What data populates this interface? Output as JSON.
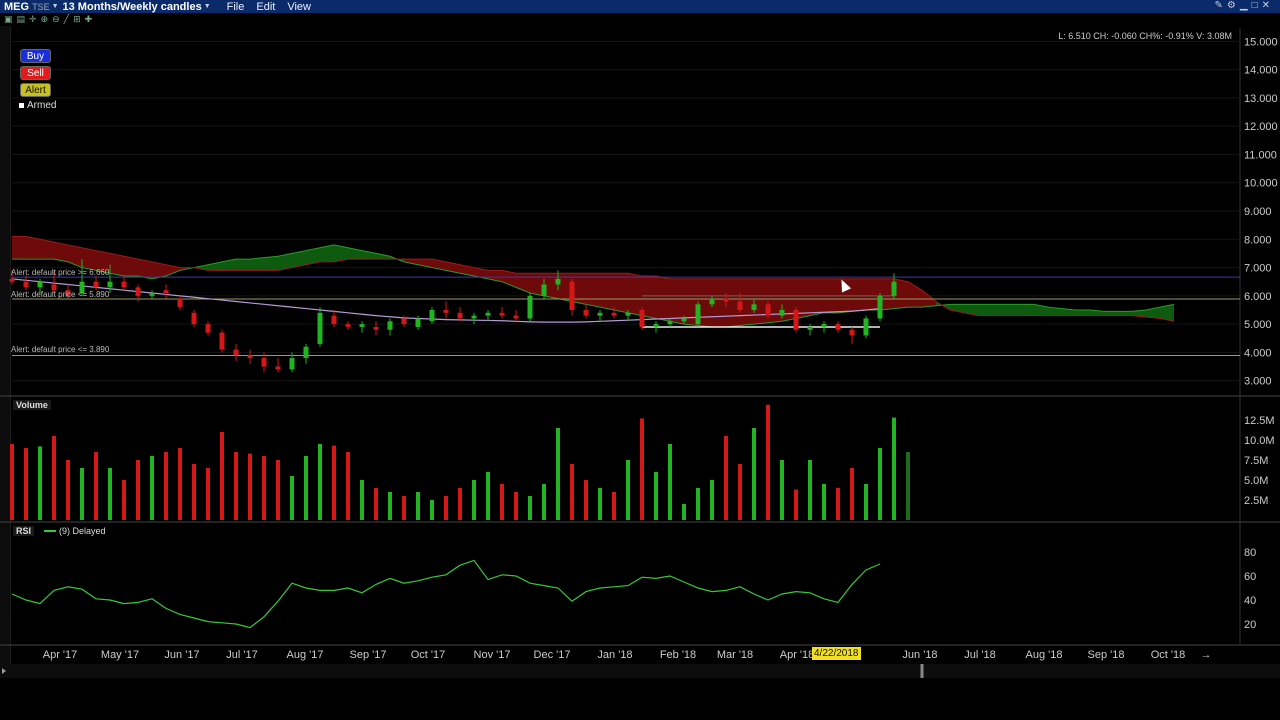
{
  "header": {
    "symbol": "MEG",
    "exchange": "TSE",
    "period": "13 Months/Weekly candles",
    "menus": [
      "File",
      "Edit",
      "View"
    ]
  },
  "actions": {
    "buy": "Buy",
    "sell": "Sell",
    "alert": "Alert",
    "armed": "Armed"
  },
  "quote": "L: 6.510  CH: -0.060  CH%: -0.91%  V: 3.08M",
  "alerts": [
    "Alert: default price >= 6.660",
    "Alert: default price <= 5.890",
    "Alert: default price <= 3.890"
  ],
  "highlighted_date": "4/22/2018",
  "panels": {
    "volume_label": "Volume",
    "rsi_label": "RSI",
    "rsi_params": "(9) Delayed"
  },
  "colors": {
    "up": "#22b422",
    "down": "#d41818",
    "cloud_bull": "#0e5a0e",
    "cloud_bear": "#6e0a0a",
    "ma": "#b49bd8",
    "rsi": "#38c838",
    "alert_line": "#9a9a62"
  },
  "chart_data": [
    {
      "type": "candlestick",
      "title": "",
      "x_tick_labels": [
        "Apr '17",
        "May '17",
        "Jun '17",
        "Jul '17",
        "Aug '17",
        "Sep '17",
        "Oct '17",
        "Nov '17",
        "Dec '17",
        "Jan '18",
        "Feb '18",
        "Mar '18",
        "Apr '18",
        "Jun '18",
        "Jul '18",
        "Aug '18",
        "Sep '18",
        "Oct '18"
      ],
      "y_tick_labels": [
        "15.000",
        "14.000",
        "13.000",
        "12.000",
        "11.000",
        "10.000",
        "9.000",
        "8.000",
        "7.000",
        "6.000",
        "5.000",
        "4.000",
        "3.000"
      ],
      "ylim": [
        2.6,
        15.4
      ],
      "candles": [
        {
          "o": 6.6,
          "h": 6.9,
          "l": 6.4,
          "c": 6.5
        },
        {
          "o": 6.5,
          "h": 6.7,
          "l": 6.2,
          "c": 6.3
        },
        {
          "o": 6.3,
          "h": 6.6,
          "l": 6.1,
          "c": 6.5
        },
        {
          "o": 6.4,
          "h": 6.9,
          "l": 6.1,
          "c": 6.2
        },
        {
          "o": 6.2,
          "h": 6.4,
          "l": 5.9,
          "c": 6.0
        },
        {
          "o": 6.1,
          "h": 7.3,
          "l": 6.0,
          "c": 6.5
        },
        {
          "o": 6.5,
          "h": 6.7,
          "l": 6.2,
          "c": 6.3
        },
        {
          "o": 6.3,
          "h": 7.1,
          "l": 6.1,
          "c": 6.5
        },
        {
          "o": 6.5,
          "h": 6.7,
          "l": 6.2,
          "c": 6.3
        },
        {
          "o": 6.3,
          "h": 6.4,
          "l": 5.8,
          "c": 6.0
        },
        {
          "o": 6.0,
          "h": 6.2,
          "l": 5.9,
          "c": 6.1
        },
        {
          "o": 6.2,
          "h": 6.4,
          "l": 5.9,
          "c": 6.1
        },
        {
          "o": 5.9,
          "h": 6.0,
          "l": 5.5,
          "c": 5.6
        },
        {
          "o": 5.4,
          "h": 5.5,
          "l": 4.9,
          "c": 5.0
        },
        {
          "o": 5.0,
          "h": 5.1,
          "l": 4.6,
          "c": 4.7
        },
        {
          "o": 4.7,
          "h": 4.8,
          "l": 4.0,
          "c": 4.1
        },
        {
          "o": 4.1,
          "h": 4.3,
          "l": 3.7,
          "c": 3.9
        },
        {
          "o": 3.9,
          "h": 4.1,
          "l": 3.6,
          "c": 3.8
        },
        {
          "o": 3.8,
          "h": 4.0,
          "l": 3.3,
          "c": 3.5
        },
        {
          "o": 3.5,
          "h": 3.8,
          "l": 3.3,
          "c": 3.4
        },
        {
          "o": 3.4,
          "h": 4.0,
          "l": 3.3,
          "c": 3.8
        },
        {
          "o": 3.8,
          "h": 4.3,
          "l": 3.6,
          "c": 4.2
        },
        {
          "o": 4.3,
          "h": 5.6,
          "l": 4.2,
          "c": 5.4
        },
        {
          "o": 5.3,
          "h": 5.5,
          "l": 4.9,
          "c": 5.0
        },
        {
          "o": 5.0,
          "h": 5.1,
          "l": 4.8,
          "c": 4.9
        },
        {
          "o": 4.9,
          "h": 5.1,
          "l": 4.7,
          "c": 5.0
        },
        {
          "o": 4.9,
          "h": 5.1,
          "l": 4.6,
          "c": 4.8
        },
        {
          "o": 4.8,
          "h": 5.2,
          "l": 4.6,
          "c": 5.1
        },
        {
          "o": 5.2,
          "h": 5.3,
          "l": 4.9,
          "c": 5.0
        },
        {
          "o": 4.9,
          "h": 5.3,
          "l": 4.8,
          "c": 5.2
        },
        {
          "o": 5.1,
          "h": 5.6,
          "l": 5.0,
          "c": 5.5
        },
        {
          "o": 5.5,
          "h": 5.8,
          "l": 5.2,
          "c": 5.4
        },
        {
          "o": 5.4,
          "h": 5.6,
          "l": 5.1,
          "c": 5.2
        },
        {
          "o": 5.2,
          "h": 5.4,
          "l": 5.0,
          "c": 5.3
        },
        {
          "o": 5.3,
          "h": 5.5,
          "l": 5.1,
          "c": 5.4
        },
        {
          "o": 5.4,
          "h": 5.6,
          "l": 5.2,
          "c": 5.3
        },
        {
          "o": 5.3,
          "h": 5.5,
          "l": 5.1,
          "c": 5.2
        },
        {
          "o": 5.2,
          "h": 6.1,
          "l": 5.1,
          "c": 6.0
        },
        {
          "o": 6.0,
          "h": 6.6,
          "l": 5.9,
          "c": 6.4
        },
        {
          "o": 6.4,
          "h": 6.9,
          "l": 6.2,
          "c": 6.6
        },
        {
          "o": 6.5,
          "h": 6.6,
          "l": 5.3,
          "c": 5.5
        },
        {
          "o": 5.5,
          "h": 5.7,
          "l": 5.2,
          "c": 5.3
        },
        {
          "o": 5.3,
          "h": 5.5,
          "l": 5.1,
          "c": 5.4
        },
        {
          "o": 5.4,
          "h": 5.6,
          "l": 5.2,
          "c": 5.3
        },
        {
          "o": 5.3,
          "h": 5.5,
          "l": 5.1,
          "c": 5.4
        },
        {
          "o": 5.5,
          "h": 5.6,
          "l": 4.8,
          "c": 4.9
        },
        {
          "o": 4.9,
          "h": 5.1,
          "l": 4.7,
          "c": 5.0
        },
        {
          "o": 5.0,
          "h": 5.2,
          "l": 4.9,
          "c": 5.1
        },
        {
          "o": 5.1,
          "h": 5.3,
          "l": 5.0,
          "c": 5.2
        },
        {
          "o": 5.0,
          "h": 5.8,
          "l": 4.9,
          "c": 5.7
        },
        {
          "o": 5.7,
          "h": 6.0,
          "l": 5.6,
          "c": 5.9
        },
        {
          "o": 5.9,
          "h": 6.1,
          "l": 5.6,
          "c": 5.8
        },
        {
          "o": 5.8,
          "h": 6.1,
          "l": 5.4,
          "c": 5.5
        },
        {
          "o": 5.5,
          "h": 5.9,
          "l": 5.4,
          "c": 5.7
        },
        {
          "o": 5.7,
          "h": 5.8,
          "l": 5.2,
          "c": 5.3
        },
        {
          "o": 5.3,
          "h": 5.7,
          "l": 5.2,
          "c": 5.5
        },
        {
          "o": 5.5,
          "h": 5.6,
          "l": 4.7,
          "c": 4.8
        },
        {
          "o": 4.8,
          "h": 5.0,
          "l": 4.6,
          "c": 4.9
        },
        {
          "o": 4.9,
          "h": 5.1,
          "l": 4.7,
          "c": 5.0
        },
        {
          "o": 5.0,
          "h": 5.1,
          "l": 4.7,
          "c": 4.8
        },
        {
          "o": 4.8,
          "h": 4.9,
          "l": 4.3,
          "c": 4.6
        },
        {
          "o": 4.6,
          "h": 5.3,
          "l": 4.5,
          "c": 5.2
        },
        {
          "o": 5.2,
          "h": 6.1,
          "l": 5.1,
          "c": 6.0
        },
        {
          "o": 6.0,
          "h": 6.8,
          "l": 5.9,
          "c": 6.5
        }
      ],
      "moving_average": [
        6.6,
        6.55,
        6.5,
        6.45,
        6.4,
        6.35,
        6.3,
        6.25,
        6.2,
        6.15,
        6.1,
        6.05,
        6.0,
        5.95,
        5.9,
        5.85,
        5.8,
        5.75,
        5.7,
        5.65,
        5.6,
        5.55,
        5.5,
        5.45,
        5.4,
        5.35,
        5.3,
        5.26,
        5.22,
        5.2,
        5.18,
        5.16,
        5.15,
        5.14,
        5.13,
        5.12,
        5.1,
        5.08,
        5.07,
        5.07,
        5.07,
        5.08,
        5.1,
        5.12,
        5.14,
        5.16,
        5.18,
        5.2,
        5.22,
        5.24,
        5.26,
        5.28,
        5.3,
        5.32,
        5.34,
        5.36,
        5.38,
        5.4,
        5.42,
        5.44,
        5.46,
        5.5,
        5.55
      ],
      "ichimoku_cloud": {
        "span_a": [
          7.3,
          7.3,
          7.3,
          7.3,
          7.2,
          7.0,
          6.9,
          6.8,
          6.7,
          6.7,
          6.6,
          6.7,
          6.9,
          7.0,
          7.1,
          7.2,
          7.3,
          7.3,
          7.35,
          7.4,
          7.5,
          7.6,
          7.7,
          7.8,
          7.7,
          7.6,
          7.5,
          7.4,
          7.2,
          7.1,
          7.0,
          6.9,
          6.8,
          6.7,
          6.6,
          6.5,
          6.3,
          6.1,
          6.0,
          5.9,
          5.8,
          5.7,
          5.6,
          5.5,
          5.4,
          5.3,
          5.2,
          5.1,
          5.0,
          4.95,
          4.9,
          4.9,
          4.95,
          5.0,
          5.05,
          5.1,
          5.2,
          5.3,
          5.4,
          5.4,
          5.45,
          5.5,
          5.5,
          5.55,
          5.6,
          5.6,
          5.65,
          5.7,
          5.7,
          5.7,
          5.7,
          5.7,
          5.7,
          5.7,
          5.6,
          5.55,
          5.5,
          5.5,
          5.45,
          5.45,
          5.45,
          5.5,
          5.6,
          5.7
        ],
        "span_b": [
          8.1,
          8.1,
          8.0,
          7.9,
          7.8,
          7.7,
          7.6,
          7.5,
          7.4,
          7.3,
          7.2,
          7.1,
          7.0,
          7.0,
          6.9,
          6.9,
          6.9,
          6.9,
          6.9,
          6.9,
          7.0,
          7.1,
          7.2,
          7.2,
          7.3,
          7.3,
          7.3,
          7.3,
          7.3,
          7.3,
          7.3,
          7.2,
          7.1,
          7.0,
          6.9,
          6.9,
          6.8,
          6.8,
          6.8,
          6.8,
          6.8,
          6.8,
          6.8,
          6.8,
          6.8,
          6.7,
          6.7,
          6.6,
          6.6,
          6.6,
          6.6,
          6.6,
          6.6,
          6.6,
          6.6,
          6.6,
          6.6,
          6.6,
          6.6,
          6.6,
          6.6,
          6.6,
          6.6,
          6.6,
          6.5,
          6.2,
          5.8,
          5.5,
          5.4,
          5.3,
          5.3,
          5.3,
          5.3,
          5.3,
          5.3,
          5.3,
          5.3,
          5.3,
          5.3,
          5.3,
          5.3,
          5.25,
          5.2,
          5.1
        ]
      },
      "alert_levels": [
        6.66,
        5.89,
        3.89
      ]
    },
    {
      "type": "bar",
      "title": "Volume",
      "y_tick_labels": [
        "12.5M",
        "10.0M",
        "7.5M",
        "5.0M",
        "2.5M"
      ],
      "ylim": [
        0,
        14.5
      ],
      "values": [
        9.5,
        9.0,
        9.2,
        10.5,
        7.5,
        6.5,
        8.5,
        6.5,
        5.0,
        7.5,
        8.0,
        8.5,
        9.0,
        7.0,
        6.5,
        11.0,
        8.5,
        8.3,
        8.0,
        7.5,
        5.5,
        8.0,
        9.5,
        9.3,
        8.5,
        5.0,
        4.0,
        3.5,
        3.0,
        3.5,
        2.5,
        3.0,
        4.0,
        5.0,
        6.0,
        4.5,
        3.5,
        3.0,
        4.5,
        11.5,
        7.0,
        5.0,
        4.0,
        3.5,
        7.5,
        12.7,
        6.0,
        9.5,
        2.0,
        4.0,
        5.0,
        10.5,
        7.0,
        11.5,
        14.4,
        7.5,
        3.8,
        7.5,
        4.5,
        4.0,
        6.5,
        4.5,
        9.0,
        12.8,
        8.5
      ]
    },
    {
      "type": "line",
      "title": "RSI",
      "y_tick_labels": [
        "80",
        "60",
        "40",
        "20"
      ],
      "ylim": [
        5,
        95
      ],
      "values": [
        45,
        40,
        37,
        48,
        51,
        49,
        41,
        40,
        37,
        38,
        41,
        33,
        28,
        25,
        22,
        21,
        20,
        17,
        26,
        39,
        54,
        50,
        48,
        48,
        50,
        46,
        53,
        58,
        54,
        56,
        59,
        61,
        69,
        73,
        57,
        61,
        60,
        54,
        52,
        50,
        39,
        47,
        50,
        51,
        52,
        59,
        58,
        60,
        55,
        50,
        47,
        48,
        51,
        45,
        40,
        45,
        47,
        46,
        41,
        38,
        53,
        65,
        70
      ]
    }
  ]
}
